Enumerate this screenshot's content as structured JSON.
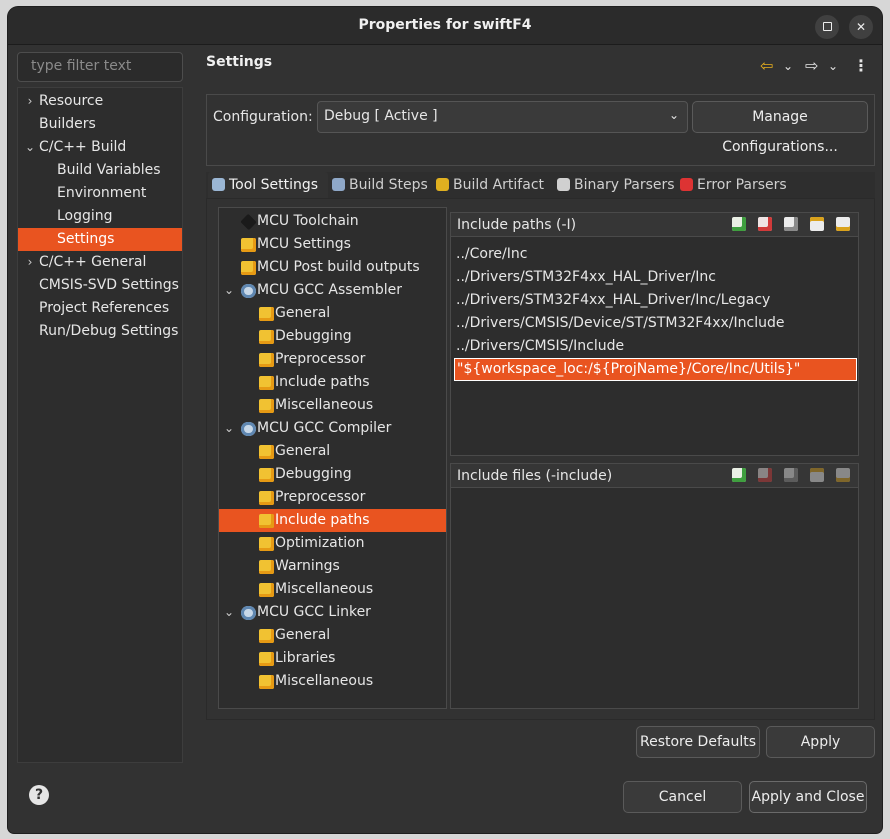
{
  "window": {
    "title": "Properties for swiftF4"
  },
  "filter": {
    "placeholder": "type filter text"
  },
  "nav": {
    "items": [
      {
        "label": "Resource",
        "chevron": ">",
        "depth": 0
      },
      {
        "label": "Builders",
        "chevron": "",
        "depth": 0
      },
      {
        "label": "C/C++ Build",
        "chevron": "v",
        "depth": 0
      },
      {
        "label": "Build Variables",
        "chevron": "",
        "depth": 1
      },
      {
        "label": "Environment",
        "chevron": "",
        "depth": 1
      },
      {
        "label": "Logging",
        "chevron": "",
        "depth": 1
      },
      {
        "label": "Settings",
        "chevron": "",
        "depth": 1,
        "selected": true
      },
      {
        "label": "C/C++ General",
        "chevron": ">",
        "depth": 0
      },
      {
        "label": "CMSIS-SVD Settings",
        "chevron": "",
        "depth": 0
      },
      {
        "label": "Project References",
        "chevron": "",
        "depth": 0
      },
      {
        "label": "Run/Debug Settings",
        "chevron": "",
        "depth": 0
      }
    ]
  },
  "settings": {
    "title": "Settings"
  },
  "config": {
    "label": "Configuration:",
    "value": "Debug  [ Active ]",
    "manage_label": "Manage Configurations..."
  },
  "tabs": [
    {
      "label": "Tool Settings",
      "icon": "gear-icon",
      "color": "#9ab6d4"
    },
    {
      "label": "Build Steps",
      "icon": "hammer-icon",
      "color": "#8fa8c8"
    },
    {
      "label": "Build Artifact",
      "icon": "trophy-icon",
      "color": "#e0b020"
    },
    {
      "label": "Binary Parsers",
      "icon": "binary-icon",
      "color": "#d0d0d0"
    },
    {
      "label": "Error Parsers",
      "icon": "error-icon",
      "color": "#d33"
    }
  ],
  "tooltree": {
    "items": [
      {
        "label": "MCU Toolchain",
        "indent": 0,
        "chevron": "",
        "icon": "chip"
      },
      {
        "label": "MCU Settings",
        "indent": 0,
        "chevron": "",
        "icon": "page"
      },
      {
        "label": "MCU Post build outputs",
        "indent": 0,
        "chevron": "",
        "icon": "page"
      },
      {
        "label": "MCU GCC Assembler",
        "indent": 0,
        "chevron": "v",
        "icon": "gear"
      },
      {
        "label": "General",
        "indent": 1,
        "chevron": "",
        "icon": "page"
      },
      {
        "label": "Debugging",
        "indent": 1,
        "chevron": "",
        "icon": "page"
      },
      {
        "label": "Preprocessor",
        "indent": 1,
        "chevron": "",
        "icon": "page"
      },
      {
        "label": "Include paths",
        "indent": 1,
        "chevron": "",
        "icon": "page"
      },
      {
        "label": "Miscellaneous",
        "indent": 1,
        "chevron": "",
        "icon": "page"
      },
      {
        "label": "MCU GCC Compiler",
        "indent": 0,
        "chevron": "v",
        "icon": "gear"
      },
      {
        "label": "General",
        "indent": 1,
        "chevron": "",
        "icon": "page"
      },
      {
        "label": "Debugging",
        "indent": 1,
        "chevron": "",
        "icon": "page"
      },
      {
        "label": "Preprocessor",
        "indent": 1,
        "chevron": "",
        "icon": "page"
      },
      {
        "label": "Include paths",
        "indent": 1,
        "chevron": "",
        "icon": "page",
        "selected": true
      },
      {
        "label": "Optimization",
        "indent": 1,
        "chevron": "",
        "icon": "page"
      },
      {
        "label": "Warnings",
        "indent": 1,
        "chevron": "",
        "icon": "page"
      },
      {
        "label": "Miscellaneous",
        "indent": 1,
        "chevron": "",
        "icon": "page"
      },
      {
        "label": "MCU GCC Linker",
        "indent": 0,
        "chevron": "v",
        "icon": "gear"
      },
      {
        "label": "General",
        "indent": 1,
        "chevron": "",
        "icon": "page"
      },
      {
        "label": "Libraries",
        "indent": 1,
        "chevron": "",
        "icon": "page"
      },
      {
        "label": "Miscellaneous",
        "indent": 1,
        "chevron": "",
        "icon": "page"
      }
    ]
  },
  "include_paths": {
    "title": "Include paths (-I)",
    "rows": [
      {
        "value": "../Core/Inc"
      },
      {
        "value": "../Drivers/STM32F4xx_HAL_Driver/Inc"
      },
      {
        "value": "../Drivers/STM32F4xx_HAL_Driver/Inc/Legacy"
      },
      {
        "value": "../Drivers/CMSIS/Device/ST/STM32F4xx/Include"
      },
      {
        "value": "../Drivers/CMSIS/Include"
      },
      {
        "value": "\"${workspace_loc:/${ProjName}/Core/Inc/Utils}\"",
        "selected": true
      }
    ]
  },
  "include_files": {
    "title": "Include files (-include)",
    "rows": []
  },
  "buttons": {
    "restore_defaults": "Restore Defaults",
    "apply": "Apply",
    "cancel": "Cancel",
    "apply_and_close": "Apply and Close"
  },
  "colors": {
    "accent": "#e95420",
    "background": "#323232"
  }
}
